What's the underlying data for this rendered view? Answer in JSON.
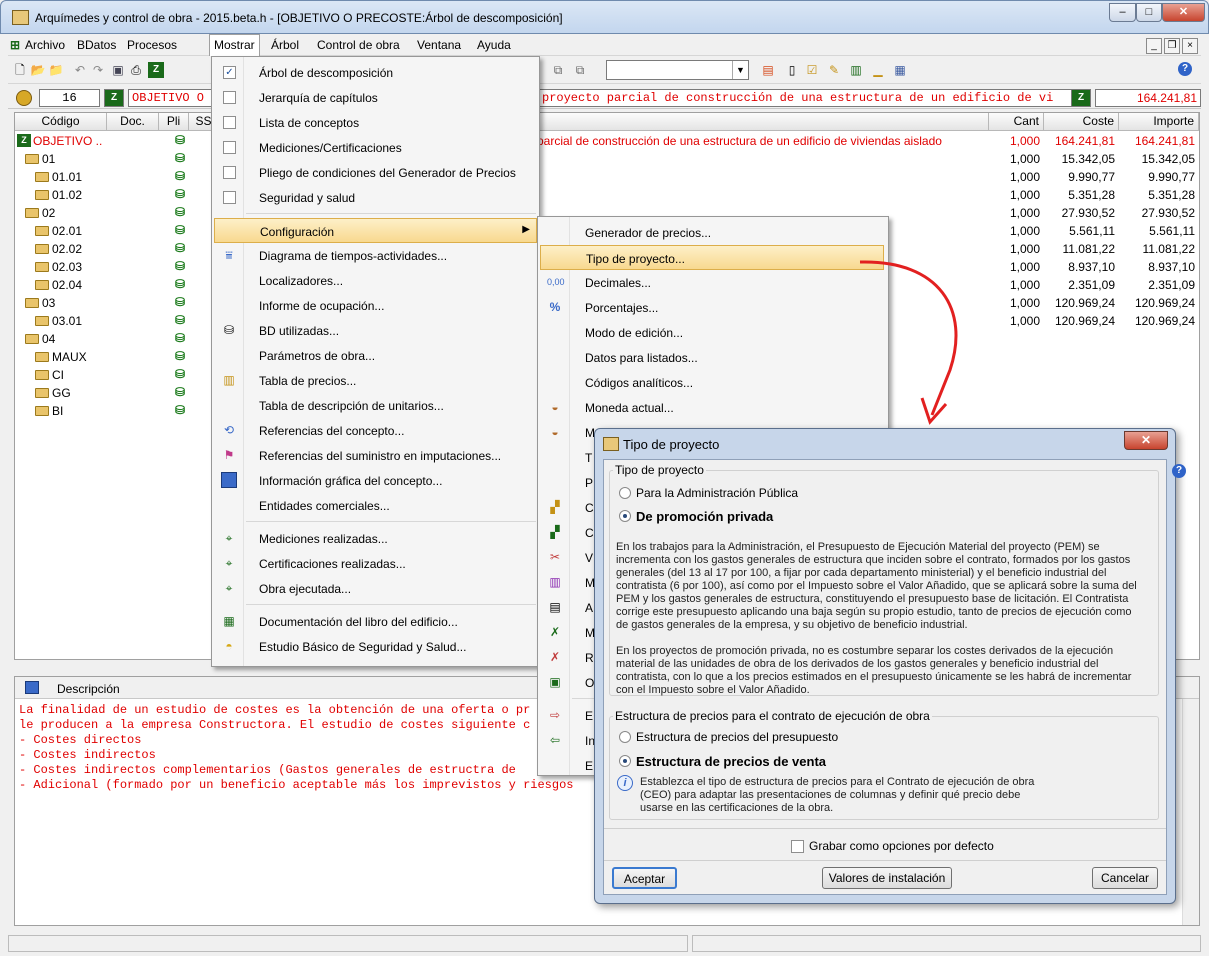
{
  "window": {
    "title": "Arquímedes y control de obra - 2015.beta.h - [OBJETIVO O PRECOSTE:Árbol de descomposición]"
  },
  "menubar": [
    "Archivo",
    "BDatos",
    "Procesos",
    "Mostrar",
    "Árbol",
    "Control de obra",
    "Ventana",
    "Ayuda"
  ],
  "addressbar": {
    "level": "16",
    "code": "OBJETIVO O",
    "summary": "proyecto parcial de construcción de una estructura de un edificio de vi",
    "total": "164.241,81"
  },
  "tree": {
    "headers": [
      "Código",
      "Doc.",
      "Pli",
      "SS",
      "Cant",
      "Coste",
      "Importe"
    ],
    "rows": [
      {
        "code": "OBJETIVO ..",
        "summary": "parcial de construcción de una estructura de un edificio de viviendas aislado",
        "cant": "1,000",
        "coste": "164.241,81",
        "importe": "164.241,81"
      },
      {
        "code": "01",
        "summary": "",
        "cant": "1,000",
        "coste": "15.342,05",
        "importe": "15.342,05"
      },
      {
        "code": "01.01",
        "summary": "",
        "cant": "1,000",
        "coste": "9.990,77",
        "importe": "9.990,77"
      },
      {
        "code": "01.02",
        "summary": "",
        "cant": "1,000",
        "coste": "5.351,28",
        "importe": "5.351,28"
      },
      {
        "code": "02",
        "summary": "",
        "cant": "1,000",
        "coste": "27.930,52",
        "importe": "27.930,52"
      },
      {
        "code": "02.01",
        "summary": "",
        "cant": "1,000",
        "coste": "5.561,11",
        "importe": "5.561,11"
      },
      {
        "code": "02.02",
        "summary": "",
        "cant": "1,000",
        "coste": "11.081,22",
        "importe": "11.081,22"
      },
      {
        "code": "02.03",
        "summary": "",
        "cant": "1,000",
        "coste": "8.937,10",
        "importe": "8.937,10"
      },
      {
        "code": "02.04",
        "summary": "",
        "cant": "1,000",
        "coste": "2.351,09",
        "importe": "2.351,09"
      },
      {
        "code": "03",
        "summary": "",
        "cant": "1,000",
        "coste": "120.969,24",
        "importe": "120.969,24"
      },
      {
        "code": "03.01",
        "summary": "",
        "cant": "1,000",
        "coste": "120.969,24",
        "importe": "120.969,24"
      },
      {
        "code": "04",
        "summary": "",
        "cant": "",
        "coste": "",
        "importe": ""
      },
      {
        "code": "MAUX",
        "summary": "",
        "cant": "",
        "coste": "",
        "importe": ""
      },
      {
        "code": "CI",
        "summary": "",
        "cant": "",
        "coste": "",
        "importe": ""
      },
      {
        "code": "GG",
        "summary": "",
        "cant": "",
        "coste": "",
        "importe": ""
      },
      {
        "code": "BI",
        "summary": "",
        "cant": "",
        "coste": "",
        "importe": ""
      }
    ]
  },
  "description": {
    "title": "Descripción",
    "lines": [
      "La finalidad de un estudio de costes es la obtención de una oferta o pr",
      "le producen a la empresa Constructora. El estudio de costes siguiente c",
      "- Costes directos",
      "- Costes indirectos",
      "- Costes indirectos complementarios (Gastos generales de estructra de",
      "- Adicional (formado por un beneficio aceptable más los imprevistos y riesgos"
    ]
  },
  "menu_mostrar": [
    "Árbol de descomposición",
    "Jerarquía de capítulos",
    "Lista de conceptos",
    "Mediciones/Certificaciones",
    "Pliego de condiciones del Generador de Precios",
    "Seguridad y salud",
    "Configuración",
    "Diagrama de tiempos-actividades...",
    "Localizadores...",
    "Informe de ocupación...",
    "BD utilizadas...",
    "Parámetros de obra...",
    "Tabla de precios...",
    "Tabla de descripción de unitarios...",
    "Referencias del concepto...",
    "Referencias del suministro en imputaciones...",
    "Información gráfica del concepto...",
    "Entidades comerciales...",
    "Mediciones realizadas...",
    "Certificaciones realizadas...",
    "Obra ejecutada...",
    "Documentación del libro del edificio...",
    "Estudio Básico de Seguridad y Salud..."
  ],
  "menu_config": [
    "Generador de precios...",
    "Tipo de proyecto...",
    "Decimales...",
    "Porcentajes...",
    "Modo de edición...",
    "Datos para listados...",
    "Códigos analíticos...",
    "Moneda actual...",
    "M",
    "T",
    "P",
    "C",
    "C",
    "V",
    "M",
    "A",
    "M",
    "R",
    "O",
    "E",
    "In",
    "E"
  ],
  "dialog": {
    "title": "Tipo de proyecto",
    "group1": "Tipo de proyecto",
    "opt1": "Para la Administración Pública",
    "opt2": "De promoción privada",
    "para1": "En los trabajos para la Administración, el Presupuesto de Ejecución Material del proyecto (PEM) se incrementa con los gastos generales de estructura que inciden sobre el contrato, formados por los gastos generales (del 13 al 17 por 100, a fijar por cada departamento ministerial) y el beneficio industrial del contratista (6 por 100), así como por el Impuesto sobre el Valor Añadido, que se aplicará sobre la suma del PEM y los gastos generales de estructura, constituyendo el presupuesto base de licitación. El Contratista corrige este presupuesto aplicando una baja según su propio estudio, tanto de precios de ejecución como de gastos generales de la empresa, y su objetivo de beneficio industrial.",
    "para2": "En los proyectos de promoción privada, no es costumbre separar los costes derivados de la ejecución material de las unidades de obra de los derivados de los gastos generales y beneficio industrial del contratista, con lo que a los precios estimados en el presupuesto únicamente se les habrá de incrementar con el Impuesto sobre el Valor Añadido.",
    "group2": "Estructura de precios para el contrato de ejecución de obra",
    "opt3": "Estructura de precios del presupuesto",
    "opt4": "Estructura de precios de venta",
    "info": "Establezca el tipo de estructura de precios para el Contrato de ejecución de obra (CEO) para adaptar las presentaciones de columnas y definir qué precio debe usarse en las certificaciones de la obra.",
    "checkbox": "Grabar como opciones por defecto",
    "btn_ok": "Aceptar",
    "btn_install": "Valores de instalación",
    "btn_cancel": "Cancelar"
  },
  "colors": {
    "accent_red": "#e00000",
    "highlight": "#f8d98f",
    "leaf_green": "#1a7a1a"
  }
}
